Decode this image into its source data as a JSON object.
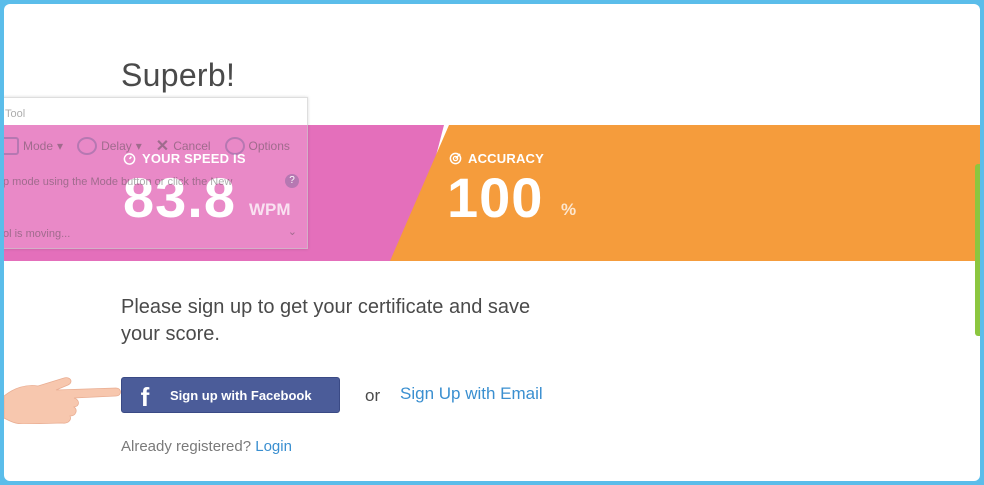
{
  "headline": "Superb!",
  "speed": {
    "label": "YOUR SPEED IS",
    "value": "83.8",
    "unit": "WPM"
  },
  "accuracy": {
    "label": "ACCURACY",
    "value": "100",
    "unit": "%"
  },
  "overlay": {
    "title": "Tool",
    "tools": [
      "Mode",
      "Delay",
      "Cancel",
      "Options"
    ],
    "hint": "p mode using the Mode button or click the New",
    "status": "ol is moving..."
  },
  "prompt": "Please sign up to get your certificate and save your score.",
  "facebook_button": {
    "label": "Sign up with Facebook",
    "icon": "f"
  },
  "or_text": "or",
  "email_link": "Sign Up with Email",
  "already": {
    "text": "Already registered?",
    "login": "Login"
  },
  "colors": {
    "speed_band": "#e46fbb",
    "accuracy_band": "#f59c3c",
    "facebook": "#4b5c99",
    "link": "#3a8fd0",
    "frame": "#5bbdea"
  }
}
